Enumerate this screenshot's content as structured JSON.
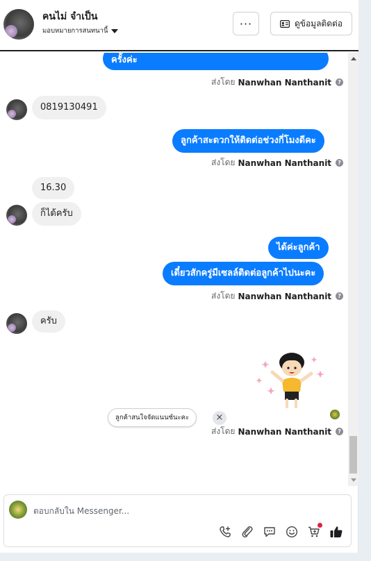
{
  "header": {
    "contact_name": "คนไม่ จำเป็น",
    "assign_label": "มอบหมายการสนทนานี้",
    "more_label": "···",
    "view_contact_label": "ดูข้อมูลติดต่อ"
  },
  "messages": [
    {
      "type": "outgoing",
      "text": "ครั้งค่ะ"
    },
    {
      "type": "sent_by",
      "prefix": "ส่งโดย",
      "name": "Nanwhan Nanthanit"
    },
    {
      "type": "incoming",
      "text": "0819130491"
    },
    {
      "type": "outgoing",
      "text": "ลูกค้าสะดวกให้ติดต่อช่วงกี่โมงดีคะ"
    },
    {
      "type": "sent_by",
      "prefix": "ส่งโดย",
      "name": "Nanwhan Nanthanit"
    },
    {
      "type": "incoming",
      "text": "16.30"
    },
    {
      "type": "incoming",
      "text": "ก็ได้ครับ"
    },
    {
      "type": "outgoing",
      "text": "ได้ค่ะลูกค้า"
    },
    {
      "type": "outgoing",
      "text": "เดี๋ยวสักครู่มีเซลล์ติดต่อลูกค้าไปนะคะ"
    },
    {
      "type": "sent_by",
      "prefix": "ส่งโดย",
      "name": "Nanwhan Nanthanit"
    },
    {
      "type": "incoming",
      "text": "ครับ"
    },
    {
      "type": "sticker",
      "icon": "girl-cheering-sticker"
    },
    {
      "type": "sent_by",
      "prefix": "ส่งโดย",
      "name": "Nanwhan Nanthanit"
    }
  ],
  "help_glyph": "?",
  "quick_reply": {
    "label": "ลูกค้าสนใจจัดแนนซ์นะคะ",
    "close": "×"
  },
  "composer": {
    "placeholder": "ตอบกลับใน Messenger..."
  },
  "tools": [
    "phone-plus-icon",
    "attachment-icon",
    "saved-reply-icon",
    "emoji-icon",
    "cart-icon",
    "like-icon"
  ],
  "colors": {
    "outgoing_bubble": "#0a7cff",
    "incoming_bubble": "#f0f0f0",
    "like": "#1c1e21"
  }
}
